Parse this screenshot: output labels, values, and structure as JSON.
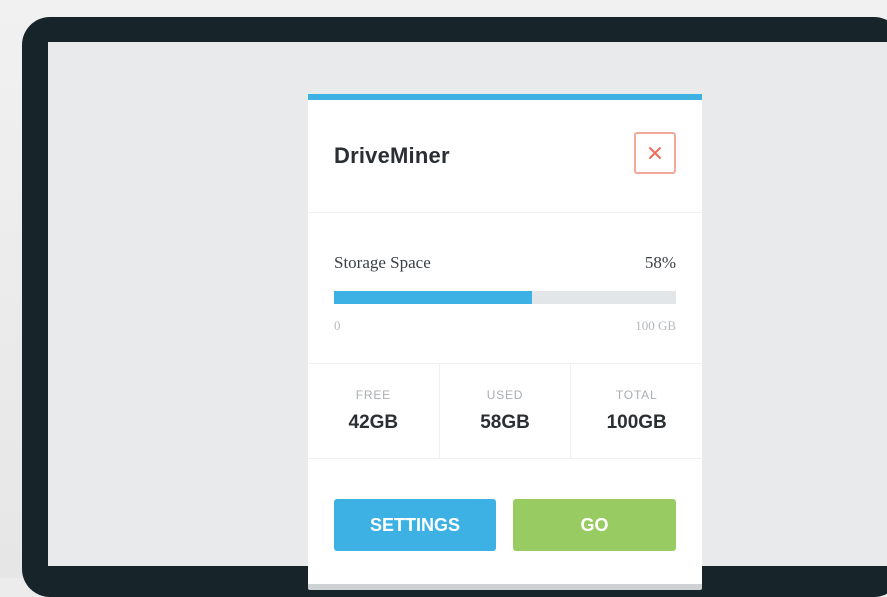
{
  "widget": {
    "title": "DriveMiner",
    "close_icon": "close-icon",
    "accent_color": "#3db1e3",
    "close_color": "#ef6e5a"
  },
  "storage": {
    "label": "Storage Space",
    "percent_label": "58%",
    "percent_used": 58,
    "range_min": "0",
    "range_max": "100 GB"
  },
  "stats": [
    {
      "label": "FREE",
      "value": "42GB"
    },
    {
      "label": "USED",
      "value": "58GB"
    },
    {
      "label": "TOTAL",
      "value": "100GB"
    }
  ],
  "actions": {
    "settings_label": "SETTINGS",
    "go_label": "GO",
    "settings_color": "#3db1e3",
    "go_color": "#98cc63"
  }
}
